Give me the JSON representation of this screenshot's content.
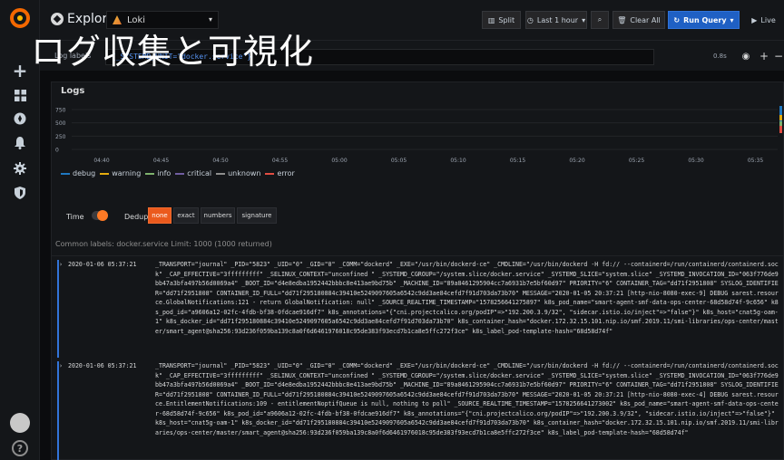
{
  "overlay": {
    "title": "ログ収集と可視化"
  },
  "topbar": {
    "title": "Explore",
    "datasource": "Loki",
    "split_label": "Split",
    "time_range": "Last 1 hour",
    "clear_all_label": "Clear All",
    "run_query_label": "Run Query",
    "live_label": "Live"
  },
  "query": {
    "label": "Log labels",
    "value": "{_SYSTEMD_UNIT=\"docker.service\"}",
    "time": "0.8s"
  },
  "logs": {
    "title": "Logs",
    "y_ticks": [
      "750",
      "500",
      "250",
      "0"
    ],
    "x_ticks": [
      "04:40",
      "04:45",
      "04:50",
      "04:55",
      "05:00",
      "05:05",
      "05:10",
      "05:15",
      "05:20",
      "05:25",
      "05:30",
      "05:35"
    ],
    "legend": [
      {
        "label": "debug",
        "color": "#1f78c1"
      },
      {
        "label": "warning",
        "color": "#e5ac0e"
      },
      {
        "label": "info",
        "color": "#7eb26d"
      },
      {
        "label": "critical",
        "color": "#705da0"
      },
      {
        "label": "unknown",
        "color": "#8e8e8e"
      },
      {
        "label": "error",
        "color": "#e24d42"
      }
    ],
    "options": {
      "time_label": "Time",
      "dedup_label": "Dedup",
      "dedup_none": "none",
      "dedup_exact": "exact",
      "dedup_numbers": "numbers",
      "dedup_signature": "signature"
    },
    "common_labels": "Common labels: docker.service   Limit: 1000 (1000 returned)",
    "entries": [
      {
        "ts": "2020-01-06 05:37:21",
        "msg": "_TRANSPORT=\"journal\" _PID=\"5823\" _UID=\"0\" _GID=\"0\" _COMM=\"dockerd\" _EXE=\"/usr/bin/dockerd-ce\" _CMDLINE=\"/usr/bin/dockerd -H fd:// --containerd=/run/containerd/containerd.sock\" _CAP_EFFECTIVE=\"3fffffffff\" _SELINUX_CONTEXT=\"unconfined \" _SYSTEMD_CGROUP=\"/system.slice/docker.service\" _SYSTEMD_SLICE=\"system.slice\" _SYSTEMD_INVOCATION_ID=\"063f776de9bb47a3bfa497b56d0069a4\" _BOOT_ID=\"d4e8edba1952442bbbc8e413ae9bd75b\" _MACHINE_ID=\"89a8461295904cc7a6931b7e5bf60d97\" PRIORITY=\"6\" CONTAINER_TAG=\"dd71f2951808\" SYSLOG_IDENTIFIER=\"dd71f2951808\" CONTAINER_ID_FULL=\"dd71f295180884c39410e5249097605a6542c9dd3ae84cefd7f91d703da73b70\" MESSAGE=\"2020-01-05 20:37:21 [http-nio-8080-exec-9] DEBUG sarest.resource.GlobalNotifications:121 - return GlobalNotification: null\" _SOURCE_REALTIME_TIMESTAMP=\"1578256641275897\" k8s_pod_name=\"smart-agent-smf-data-ops-center-68d58d74f-9c656\" k8s_pod_id=\"a9606a12-02fc-4fdb-bf38-0fdcae916df7\" k8s_annotations=\"{\"cni.projectcalico.org/podIP\"=>\"192.200.3.9/32\", \"sidecar.istio.io/inject\"=>\"false\"}\" k8s_host=\"cnat5g-oam-1\" k8s_docker_id=\"dd71f295180884c39410e5249097605a6542c9dd3ae84cefd7f91d703da73b70\" k8s_container_hash=\"docker.172.32.15.101.nip.io/smf.2019.11/smi-libraries/ops-center/master/smart_agent@sha256:93d236f059ba139c8a0f6d6461976018c95de383f93ecd7b1ca8e5ffc272f3ce\" k8s_label_pod-template-hash=\"68d58d74f\""
      },
      {
        "ts": "2020-01-06 05:37:21",
        "msg": "_TRANSPORT=\"journal\" _PID=\"5823\" _UID=\"0\" _GID=\"0\" _COMM=\"dockerd\" _EXE=\"/usr/bin/dockerd-ce\" _CMDLINE=\"/usr/bin/dockerd -H fd:// --containerd=/run/containerd/containerd.sock\" _CAP_EFFECTIVE=\"3fffffffff\" _SELINUX_CONTEXT=\"unconfined \" _SYSTEMD_CGROUP=\"/system.slice/docker.service\" _SYSTEMD_SLICE=\"system.slice\" _SYSTEMD_INVOCATION_ID=\"063f776de9bb47a3bfa497b56d0069a4\" _BOOT_ID=\"d4e8edba1952442bbbc8e413ae9bd75b\" _MACHINE_ID=\"89a8461295904cc7a6931b7e5bf60d97\" PRIORITY=\"6\" CONTAINER_TAG=\"dd71f2951808\" SYSLOG_IDENTIFIER=\"dd71f2951808\" CONTAINER_ID_FULL=\"dd71f295180884c39410e5249097605a6542c9dd3ae84cefd7f91d703da73b70\" MESSAGE=\"2020-01-05 20:37:21 [http-nio-8080-exec-4] DEBUG sarest.resource.EntitlementNotifications:109 - entitlementNoptifQueue is null, nothing to poll\" _SOURCE_REALTIME_TIMESTAMP=\"1578256641273002\" k8s_pod_name=\"smart-agent-smf-data-ops-center-68d58d74f-9c656\" k8s_pod_id=\"a9606a12-02fc-4fdb-bf38-0fdcae916df7\" k8s_annotations=\"{\"cni.projectcalico.org/podIP\"=>\"192.200.3.9/32\", \"sidecar.istio.io/inject\"=>\"false\"}\" k8s_host=\"cnat5g-oam-1\" k8s_docker_id=\"dd71f295180884c39410e5249097605a6542c9dd3ae84cefd7f91d703da73b70\" k8s_container_hash=\"docker.172.32.15.101.nip.io/smf.2019.11/smi-libraries/ops-center/master/smart_agent@sha256:93d236f059ba139c8a0f6d6461976018c95de383f93ecd7b1ca8e5ffc272f3ce\" k8s_label_pod-template-hash=\"68d58d74f\""
      }
    ]
  },
  "sidebar": {
    "add": "+",
    "help": "?"
  }
}
